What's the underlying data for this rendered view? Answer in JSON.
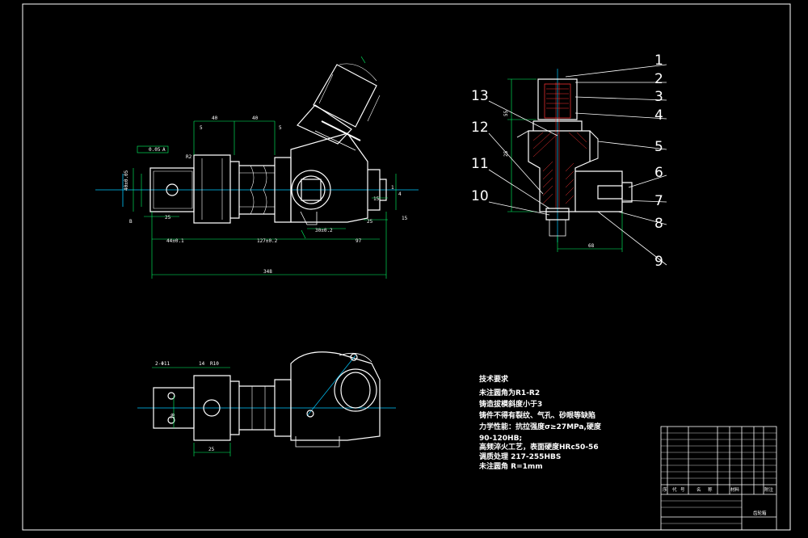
{
  "technical_requirements": {
    "title": "技术要求",
    "lines": [
      "未注圆角为R1-R2",
      "铸造拔模斜度小于3",
      "铸件不得有裂纹、气孔、砂眼等缺陷",
      "力学性能：抗拉强度σ≥27MPa,硬度",
      "90-120HB;",
      "高频淬火工艺，表面硬度HRc50-56",
      "调质处理      217-255HBS",
      "未注圆角      R=1mm"
    ]
  },
  "callouts": [
    "1",
    "2",
    "3",
    "4",
    "5",
    "6",
    "7",
    "8",
    "9",
    "10",
    "11",
    "12",
    "13"
  ],
  "dimensions": {
    "top_view": [
      "40",
      "40",
      "5",
      "5",
      "R2",
      "25",
      "44±0.1",
      "127±0.2",
      "97",
      "15",
      "25",
      "B",
      "15",
      "0.05",
      "A",
      "40±0.05",
      "30±0.2",
      "1",
      "4"
    ],
    "section_view": [
      "55",
      "25",
      "68"
    ],
    "overall": "348",
    "bottom_view": [
      "2-Φ11",
      "14",
      "R10",
      "20",
      "25"
    ]
  },
  "title_block": {
    "drawing_name": "齿轮箱",
    "header_row": [
      "序",
      "代",
      "号",
      "名",
      "称",
      "材料",
      "附注"
    ]
  },
  "colors": {
    "background": "#000000",
    "line": "#ffffff",
    "centerline": "#00c8ff",
    "dimension": "#00ff66",
    "hatch": "#ff3333",
    "leader": "#ffffff"
  }
}
